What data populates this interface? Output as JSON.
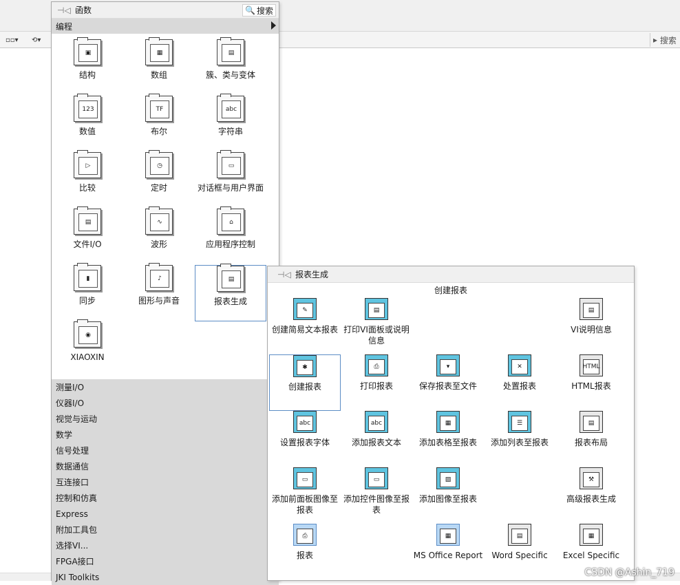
{
  "background": {
    "search_label": "搜索",
    "toolbar_icons": [
      "distribute-icon",
      "reorder-icon"
    ]
  },
  "palette": {
    "title": "函数",
    "search_label": "搜索",
    "category": "编程",
    "items": [
      {
        "label": "结构",
        "icon": "structures-icon"
      },
      {
        "label": "数组",
        "icon": "array-icon"
      },
      {
        "label": "簇、类与变体",
        "icon": "cluster-icon"
      },
      {
        "label": "数值",
        "icon": "numeric-icon"
      },
      {
        "label": "布尔",
        "icon": "boolean-icon"
      },
      {
        "label": "字符串",
        "icon": "string-icon"
      },
      {
        "label": "比较",
        "icon": "comparison-icon"
      },
      {
        "label": "定时",
        "icon": "timing-icon"
      },
      {
        "label": "对话框与用户界面",
        "icon": "dialog-icon"
      },
      {
        "label": "文件I/O",
        "icon": "file-io-icon"
      },
      {
        "label": "波形",
        "icon": "waveform-icon"
      },
      {
        "label": "应用程序控制",
        "icon": "app-control-icon"
      },
      {
        "label": "同步",
        "icon": "sync-icon"
      },
      {
        "label": "图形与声音",
        "icon": "graphics-sound-icon"
      },
      {
        "label": "报表生成",
        "icon": "report-icon"
      },
      {
        "label": "XIAOXIN",
        "icon": "xiaoxin-icon"
      }
    ],
    "categories": [
      "测量I/O",
      "仪器I/O",
      "视觉与运动",
      "数学",
      "信号处理",
      "数据通信",
      "互连接口",
      "控制和仿真",
      "Express",
      "附加工具包",
      "选择VI...",
      "FPGA接口",
      "JKI Toolkits"
    ]
  },
  "sub": {
    "title": "报表生成",
    "section": "创建报表",
    "items": [
      {
        "label": "创建简易文本报表",
        "icon": "easy-text-report-icon"
      },
      {
        "label": "打印VI面板或说明信息",
        "icon": "print-vi-panel-icon"
      },
      {
        "label": "VI说明信息",
        "icon": "vi-doc-icon"
      },
      {
        "label": "创建报表",
        "icon": "new-report-icon"
      },
      {
        "label": "打印报表",
        "icon": "print-report-icon"
      },
      {
        "label": "保存报表至文件",
        "icon": "save-report-icon"
      },
      {
        "label": "处置报表",
        "icon": "dispose-report-icon"
      },
      {
        "label": "HTML报表",
        "icon": "html-report-icon"
      },
      {
        "label": "设置报表字体",
        "icon": "set-font-icon"
      },
      {
        "label": "添加报表文本",
        "icon": "append-text-icon"
      },
      {
        "label": "添加表格至报表",
        "icon": "append-table-icon"
      },
      {
        "label": "添加列表至报表",
        "icon": "append-list-icon"
      },
      {
        "label": "报表布局",
        "icon": "report-layout-icon"
      },
      {
        "label": "添加前面板图像至报表",
        "icon": "append-fp-image-icon"
      },
      {
        "label": "添加控件图像至报表",
        "icon": "append-control-image-icon"
      },
      {
        "label": "添加图像至报表",
        "icon": "append-image-icon"
      },
      {
        "label": "高级报表生成",
        "icon": "advanced-report-icon"
      },
      {
        "label": "报表",
        "icon": "report-express-icon"
      },
      {
        "label": "MS Office Report",
        "icon": "ms-office-icon"
      },
      {
        "label": "Word Specific",
        "icon": "word-icon"
      },
      {
        "label": "Excel Specific",
        "icon": "excel-icon"
      }
    ]
  },
  "watermark": "CSDN @Ashin_719"
}
